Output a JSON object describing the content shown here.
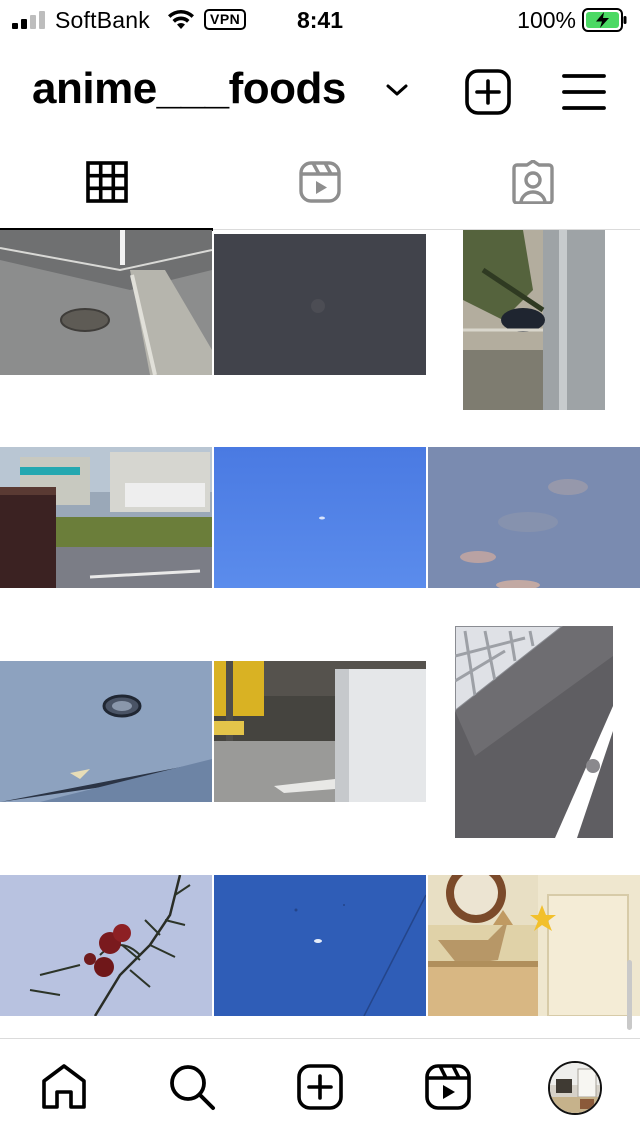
{
  "status_bar": {
    "carrier": "SoftBank",
    "vpn": "VPN",
    "time": "8:41",
    "battery": "100%"
  },
  "header": {
    "username": "anime___foods",
    "icons": [
      "chevron-down-icon",
      "create-post-icon",
      "menu-icon"
    ]
  },
  "tabs": [
    {
      "name": "posts-grid",
      "icon": "grid-icon",
      "active": true
    },
    {
      "name": "reels",
      "icon": "reels-icon",
      "active": false
    },
    {
      "name": "tagged",
      "icon": "tagged-icon",
      "active": false
    }
  ],
  "grid": {
    "columns": 3,
    "posts": [
      {
        "subject": "road corner with manhole"
      },
      {
        "subject": "dark night sky with moon"
      },
      {
        "subject": "tree leaves by building"
      },
      {
        "subject": "bus terminal street"
      },
      {
        "subject": "blue sky with moon"
      },
      {
        "subject": "dusk sky with clouds"
      },
      {
        "subject": "asphalt manhole cover"
      },
      {
        "subject": "parking area with white box"
      },
      {
        "subject": "overhead structure and road line"
      },
      {
        "subject": "red roses against sky"
      },
      {
        "subject": "deep blue sky with moon"
      },
      {
        "subject": "wooden ornaments in room"
      }
    ]
  },
  "bottom_nav": [
    {
      "name": "home",
      "icon": "home-icon"
    },
    {
      "name": "search",
      "icon": "search-icon"
    },
    {
      "name": "create",
      "icon": "create-icon"
    },
    {
      "name": "reels",
      "icon": "reels-icon"
    },
    {
      "name": "profile",
      "icon": "profile-avatar"
    }
  ],
  "colors": {
    "battery_charge": "#4cd964",
    "divider": "#dbdbdb"
  }
}
